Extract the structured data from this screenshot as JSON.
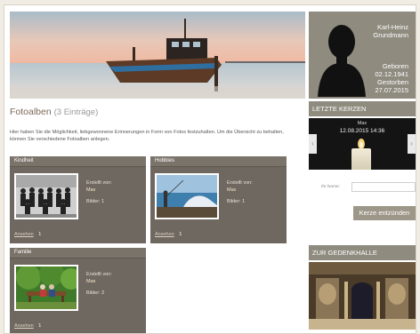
{
  "profile": {
    "name_line1": "Karl-Heinz",
    "name_line2": "Grundmann",
    "born_label": "Geboren",
    "born_date": "02.12.1941",
    "died_label": "Gestorben",
    "died_date": "27.07.2015"
  },
  "main": {
    "title": "Fotoalben",
    "count": "(3 Einträge)",
    "intro": "Hier haben Sie die Möglichkeit, liebgewonnene Erinnerungen in Form von Fotos festzuhalten. Um die Übersicht zu behalten, können Sie verschiedene Fotoalben anlegen."
  },
  "albums": [
    {
      "title": "Kindheit",
      "created_label": "Erstellt von:",
      "created_by": "Max",
      "pics_label": "Bilder:",
      "pics": "1",
      "link": "Ansehen",
      "link_count": "1"
    },
    {
      "title": "Hobbies",
      "created_label": "Erstellt von:",
      "created_by": "Max",
      "pics_label": "Bilder:",
      "pics": "1",
      "link": "Ansehen",
      "link_count": "1"
    },
    {
      "title": "Familie",
      "created_label": "Erstellt von:",
      "created_by": "Max",
      "pics_label": "Bilder:",
      "pics": "2",
      "link": "Ansehen",
      "link_count": "1"
    }
  ],
  "sidebar": {
    "candles_title": "LETZTE KERZEN",
    "candle_by": "Max",
    "candle_time": "12.08.2015 14:36",
    "name_label": "Ihr Name:",
    "name_value": "",
    "button_label": "Kerze entzünden",
    "hall_title": "ZUR GEDENKHALLE"
  },
  "colors": {
    "accent": "#8f8b7f",
    "album_bg": "#6f6860",
    "title": "#7a6a54"
  }
}
